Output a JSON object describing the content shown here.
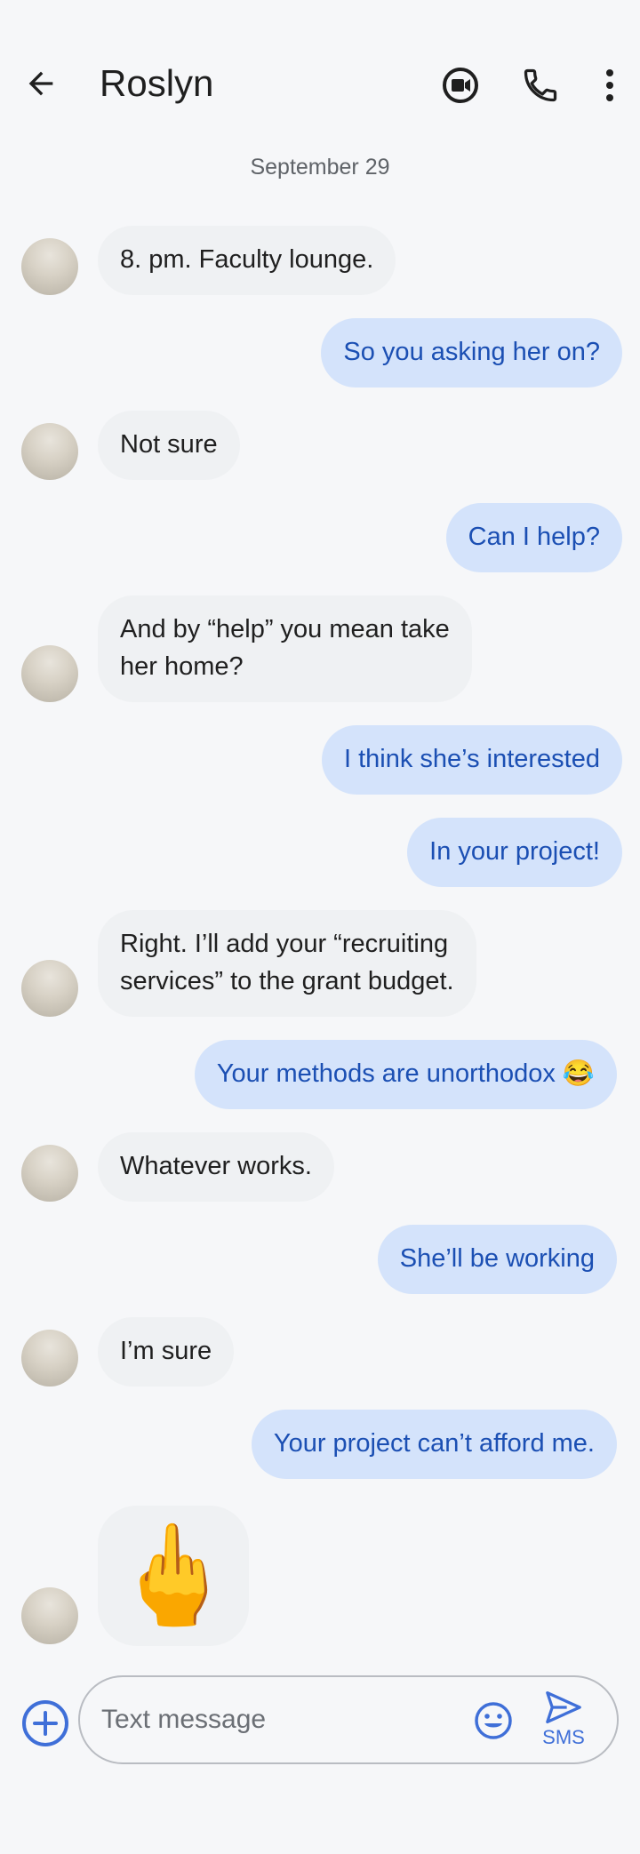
{
  "header": {
    "contact_name": "Roslyn"
  },
  "thread": {
    "date": "September 29",
    "messages": [
      {
        "dir": "in",
        "text": "8. pm. Faculty lounge."
      },
      {
        "dir": "out",
        "text": "So you asking her on?"
      },
      {
        "dir": "in",
        "text": "Not sure"
      },
      {
        "dir": "out",
        "text": "Can I help?"
      },
      {
        "dir": "in",
        "line1": "And by “help” you mean take",
        "line2": "her home?"
      },
      {
        "dir": "out",
        "text": "I think she’s interested"
      },
      {
        "dir": "out",
        "text": "In your project!"
      },
      {
        "dir": "in",
        "line1": "Right. I’ll add your “recruiting",
        "line2": "services” to the grant budget."
      },
      {
        "dir": "out",
        "text": "Your methods are unorthodox 😂"
      },
      {
        "dir": "in",
        "text": "Whatever works."
      },
      {
        "dir": "out",
        "text": "She’ll be working"
      },
      {
        "dir": "in",
        "text": "I’m sure"
      },
      {
        "dir": "out",
        "text": "Your project can’t afford me."
      },
      {
        "dir": "in",
        "text": "🖕"
      }
    ]
  },
  "composer": {
    "placeholder": "Text message",
    "send_label": "SMS"
  },
  "colors": {
    "accent": "#3f6fd8",
    "incoming_bubble": "#eff1f3",
    "outgoing_bubble": "#d4e3fb",
    "outgoing_text": "#1b4fb3"
  }
}
